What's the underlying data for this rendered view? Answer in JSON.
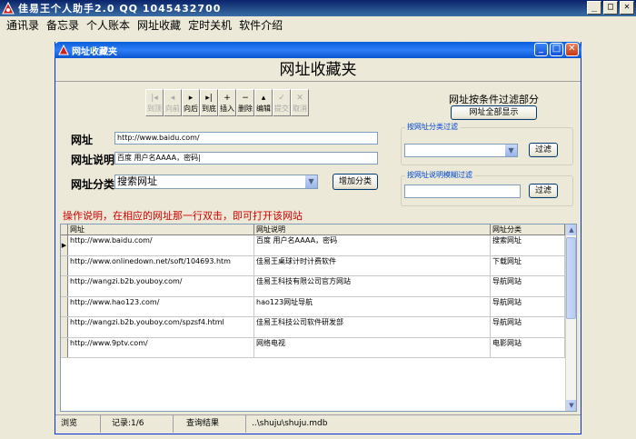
{
  "app": {
    "title": "佳易王个人助手2.0   QQ 1045432700",
    "min": "_",
    "max": "□",
    "close": "✕"
  },
  "menu": [
    "通讯录",
    "备忘录",
    "个人账本",
    "网址收藏",
    "定时关机",
    "软件介绍"
  ],
  "window": {
    "title": "网址收藏夹",
    "heading": "网址收藏夹",
    "min": "_",
    "max": "□",
    "close": "✕"
  },
  "toolbar": [
    {
      "glyph": "|◂",
      "label": "到顶",
      "enabled": false
    },
    {
      "glyph": "◂",
      "label": "向前",
      "enabled": false
    },
    {
      "glyph": "▸",
      "label": "向后",
      "enabled": true
    },
    {
      "glyph": "▸|",
      "label": "到底",
      "enabled": true
    },
    {
      "glyph": "+",
      "label": "插入",
      "enabled": true
    },
    {
      "glyph": "−",
      "label": "删除",
      "enabled": true
    },
    {
      "glyph": "▴",
      "label": "编辑",
      "enabled": true
    },
    {
      "glyph": "✓",
      "label": "提交",
      "enabled": false
    },
    {
      "glyph": "✕",
      "label": "取消",
      "enabled": false
    }
  ],
  "form": {
    "url_label": "网址",
    "url_value": "http://www.baidu.com/",
    "desc_label": "网址说明",
    "desc_value": "百度  用户名AAAA，密码|",
    "cat_label": "网址分类",
    "cat_value": "搜索网址",
    "add_cat_button": "增加分类"
  },
  "filter": {
    "title": "网址按条件过滤部分",
    "show_all_button": "网址全部显示",
    "by_cat_legend": "按网址分类过滤",
    "by_cat_value": "",
    "by_cat_button": "过滤",
    "by_desc_legend": "按网址说明模糊过滤",
    "by_desc_value": "",
    "by_desc_button": "过滤"
  },
  "notice": "操作说明，在相应的网址那一行双击，即可打开该网站",
  "grid": {
    "columns": [
      "网址",
      "网址说明",
      "网址分类"
    ],
    "rows": [
      {
        "url": "http://www.baidu.com/",
        "desc": "百度   用户名AAAA，密码",
        "cat": "搜索网址",
        "current": true
      },
      {
        "url": "http://www.onlinedown.net/soft/104693.htm",
        "desc": "佳易王桌球计时计费软件",
        "cat": "下载网址",
        "current": false
      },
      {
        "url": "http://wangzi.b2b.youboy.com/",
        "desc": "佳易王科技有限公司官方网站",
        "cat": "导航网站",
        "current": false
      },
      {
        "url": "http://www.hao123.com/",
        "desc": "hao123网址导航",
        "cat": "导航网站",
        "current": false
      },
      {
        "url": "http://wangzi.b2b.youboy.com/spzsf4.html",
        "desc": "佳易王科技公司软件研发部",
        "cat": "导航网站",
        "current": false
      },
      {
        "url": "http://www.9ptv.com/",
        "desc": "网络电视",
        "cat": "电影网站",
        "current": false
      }
    ],
    "row_marker": "▶"
  },
  "status": {
    "mode": "浏览",
    "record": "记录:1/6",
    "result": "查询结果",
    "path": "..\\shuju\\shuju.mdb"
  }
}
